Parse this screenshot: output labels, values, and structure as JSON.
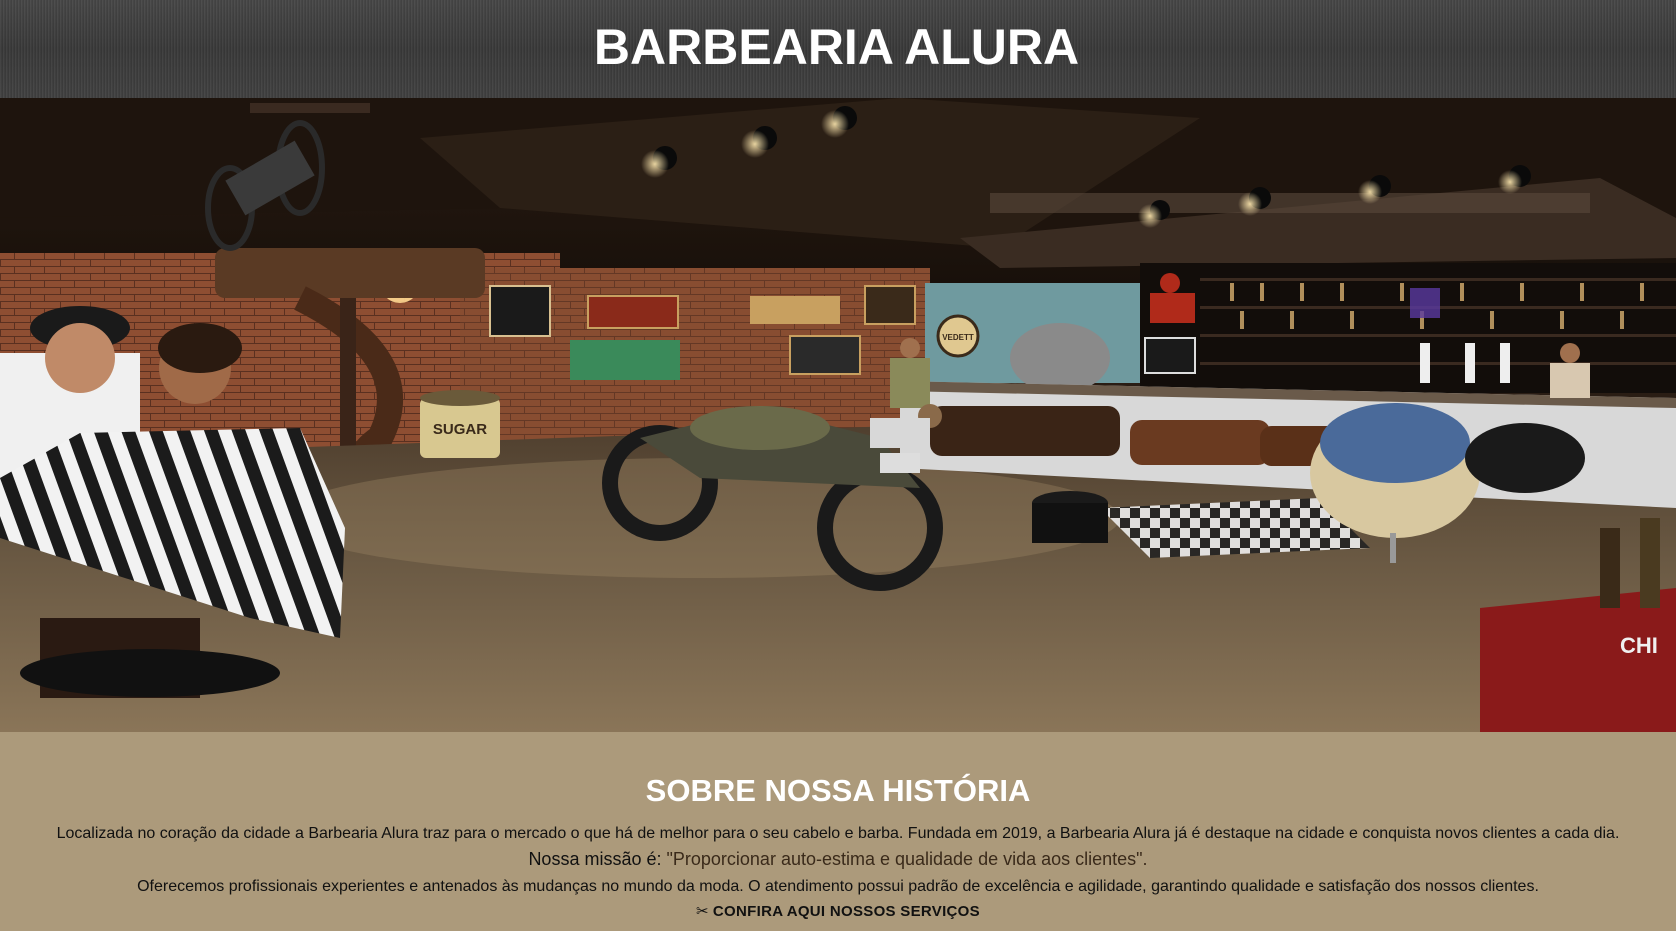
{
  "header": {
    "title": "BARBEARIA ALURA"
  },
  "banner": {
    "signs": {
      "peace": "☮",
      "sugar": "SUGAR",
      "vedett": "VEDETT",
      "chi": "CHI"
    }
  },
  "about": {
    "heading": "SOBRE NOSSA HISTÓRIA",
    "paragraph1": "Localizada no coração da cidade a Barbearia Alura traz para o mercado o que há de melhor para o seu cabelo e barba. Fundada em 2019, a Barbearia Alura já é destaque na cidade e conquista novos clientes a cada dia.",
    "mission_label": "Nossa missão é: ",
    "mission_quote": "\"Proporcionar auto-estima e qualidade de vida aos clientes\".",
    "paragraph2": "Oferecemos profissionais experientes e antenados às mudanças no mundo da moda. O atendimento possui padrão de excelência e agilidade, garantindo qualidade e satisfação dos nossos clientes.",
    "services_link_icon": "✂",
    "services_link": "CONFIRA AQUI NOSSOS SERVIÇOS"
  },
  "colors": {
    "header_bg": "#3a3a3a",
    "section_bg": "#ac9a7b",
    "heading_text": "#ffffff",
    "body_text": "#111111"
  }
}
